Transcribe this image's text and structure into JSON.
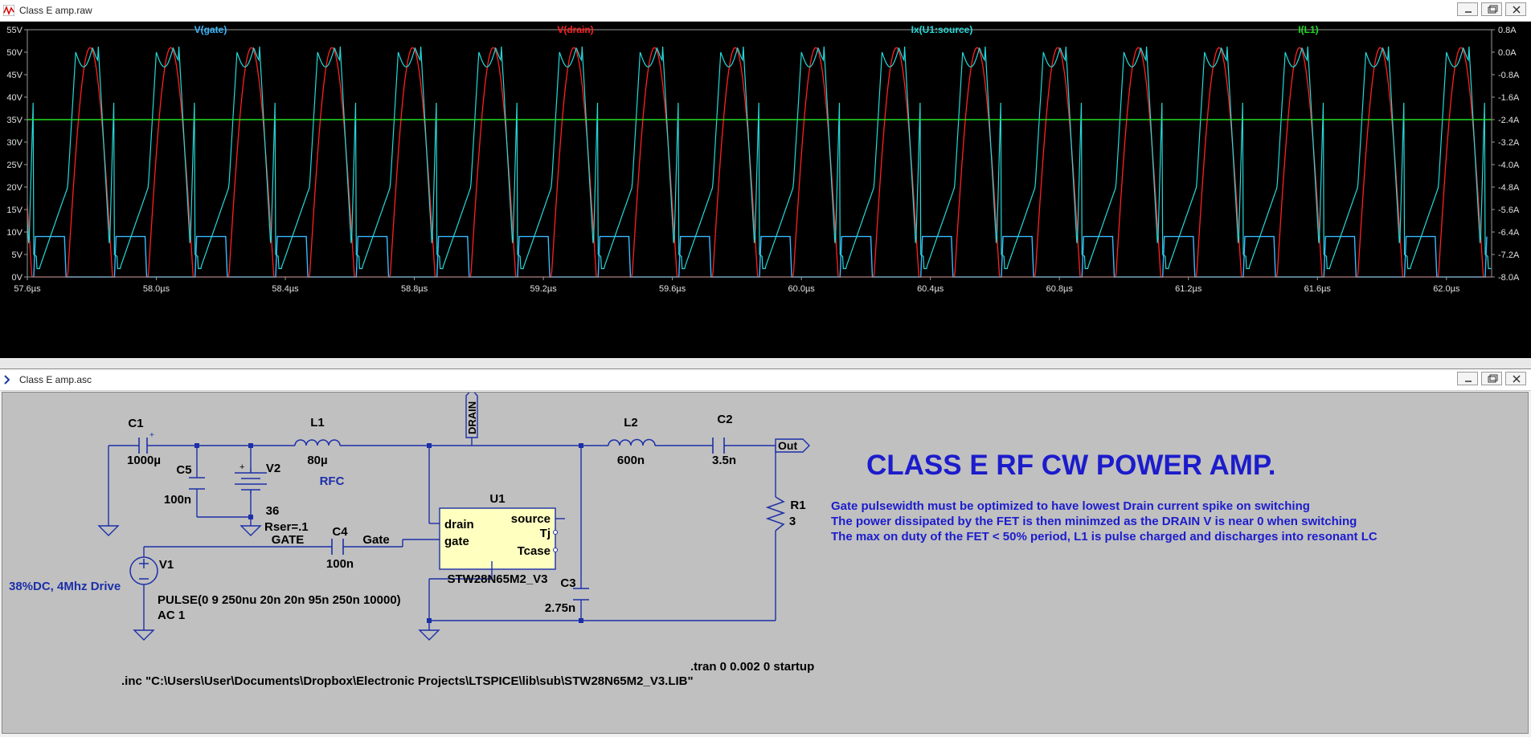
{
  "plot_window": {
    "title": "Class E amp.raw",
    "legend": [
      {
        "label": "V(gate)",
        "color": "#3ab8ff"
      },
      {
        "label": "V(drain)",
        "color": "#ff2020"
      },
      {
        "label": "Ix(U1:source)",
        "color": "#26d9d9"
      },
      {
        "label": "I(L1)",
        "color": "#22dd22"
      }
    ],
    "y_left_ticks": [
      "55V",
      "50V",
      "45V",
      "40V",
      "35V",
      "30V",
      "25V",
      "20V",
      "15V",
      "10V",
      "5V",
      "0V"
    ],
    "y_right_ticks": [
      "0.8A",
      "0.0A",
      "-0.8A",
      "-1.6A",
      "-2.4A",
      "-3.2A",
      "-4.0A",
      "-4.8A",
      "-5.6A",
      "-6.4A",
      "-7.2A",
      "-8.0A"
    ],
    "x_ticks": [
      "57.6µs",
      "58.0µs",
      "58.4µs",
      "58.8µs",
      "59.2µs",
      "59.6µs",
      "60.0µs",
      "60.4µs",
      "60.8µs",
      "61.2µs",
      "61.6µs",
      "62.0µs"
    ]
  },
  "chart_data": {
    "type": "line",
    "xlabel": "",
    "x_unit": "µs",
    "xlim": [
      57.6,
      62.14
    ],
    "ylim_left": [
      0,
      55
    ],
    "ylim_right": [
      -8.0,
      0.8
    ],
    "period_us": 0.25,
    "x_first_gate_rise_us": 57.62,
    "series": [
      {
        "name": "V(gate)",
        "axis": "left",
        "shape": "pulse",
        "low": 0,
        "high": 9,
        "pulse_width_us": 0.095
      },
      {
        "name": "V(drain)",
        "axis": "left",
        "shape": "resonant-half-sine",
        "min": 0,
        "peak": 51
      },
      {
        "name": "Ix(U1:source)",
        "axis": "right",
        "shape": "switching-current",
        "min": -8.0,
        "peak": 0.2
      },
      {
        "name": "I(L1)",
        "axis": "right",
        "shape": "flat",
        "value": -2.4
      }
    ]
  },
  "schematic_window": {
    "title": "Class E amp.asc",
    "components": {
      "c1": {
        "name": "C1",
        "value": "1000µ"
      },
      "c5": {
        "name": "C5",
        "value": "100n"
      },
      "v2": {
        "name": "V2",
        "value": "36",
        "extra": "Rser=.1"
      },
      "l1": {
        "name": "L1",
        "value": "80µ",
        "note": "RFC"
      },
      "drain_flag": "DRAIN",
      "l2": {
        "name": "L2",
        "value": "600n"
      },
      "c2": {
        "name": "C2",
        "value": "3.5n"
      },
      "out_flag": "Out",
      "r1": {
        "name": "R1",
        "value": "3"
      },
      "u1": {
        "name": "U1",
        "part": "STW28N65M2_V3",
        "pins": [
          "drain",
          "gate",
          "source",
          "Tj",
          "Tcase"
        ]
      },
      "c4": {
        "name": "C4",
        "value": "100n"
      },
      "gate_label_left": "GATE",
      "gate_label_right": "Gate",
      "v1": {
        "name": "V1",
        "value": "PULSE(0 9 250nu 20n 20n 95n 250n 10000)",
        "ac": "AC 1",
        "note": "38%DC, 4Mhz Drive"
      },
      "c3": {
        "name": "C3",
        "value": "2.75n"
      }
    },
    "heading": "CLASS E RF CW POWER AMP.",
    "notes": [
      "Gate pulsewidth must be optimized to have lowest Drain current spike on switching",
      "The power dissipated by the FET is then minimzed as the DRAIN V is near 0 when switching",
      "The max on duty of the FET  < 50% period, L1 is pulse charged and discharges into resonant LC"
    ],
    "tran": ".tran 0 0.002 0 startup",
    "include": ".inc \"C:\\Users\\User\\Documents\\Dropbox\\Electronic Projects\\LTSPICE\\lib\\sub\\STW28N65M2_V3.LIB\""
  }
}
